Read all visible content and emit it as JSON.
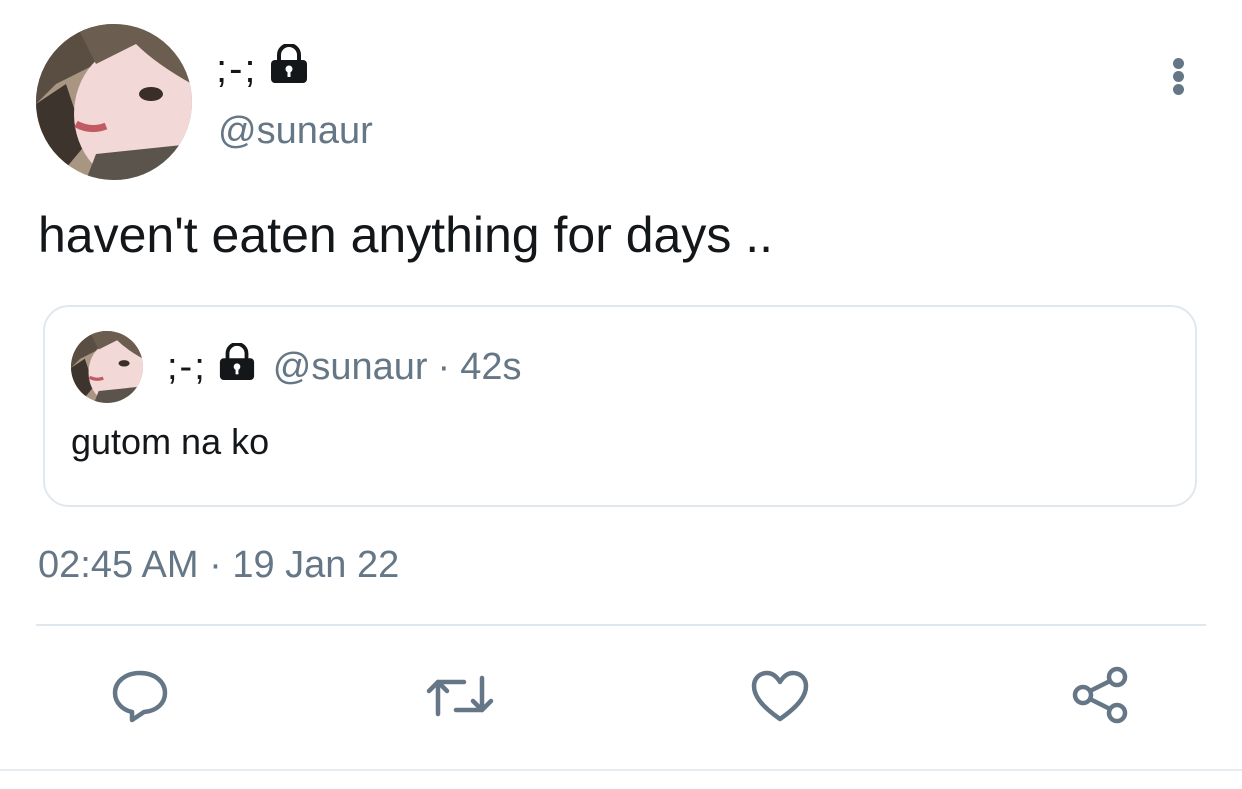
{
  "tweet": {
    "author": {
      "display_name": ";-;",
      "handle": "@sunaur",
      "protected_icon": "lock-icon"
    },
    "text": "haven't eaten anything for days ..",
    "timestamp": "02:45 AM · 19 Jan 22",
    "more_icon": "more-vertical-icon"
  },
  "quote": {
    "display_name": ";-;",
    "handle": "@sunaur",
    "separator": "·",
    "time": "42s",
    "text": "gutom na ko"
  },
  "actions": [
    {
      "icon": "reply-icon"
    },
    {
      "icon": "retweet-icon"
    },
    {
      "icon": "like-icon"
    },
    {
      "icon": "share-icon"
    }
  ],
  "colors": {
    "text_primary": "#14171a",
    "text_secondary": "#657786",
    "border": "#e1e8ed"
  }
}
